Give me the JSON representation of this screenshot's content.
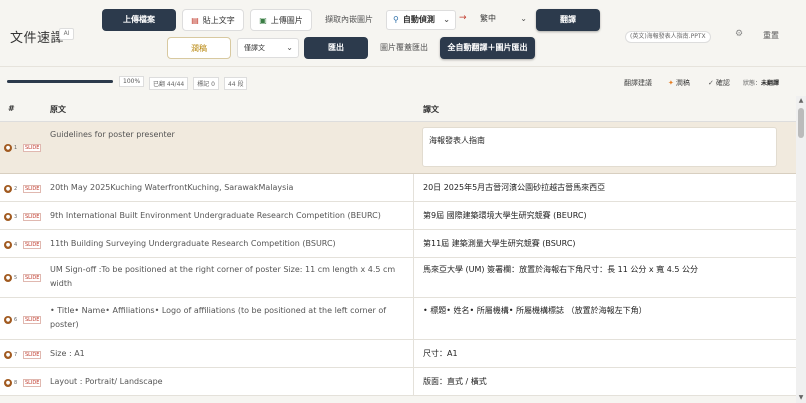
{
  "header": {
    "brand": "文件速譯",
    "ai_badge": "AI",
    "upload_file": "上傳檔案",
    "paste_text": "貼上文字",
    "upload_image": "上傳圖片",
    "capture_images": "擷取內嵌圖片",
    "source_lang": "自動偵測",
    "target_lang": "繁中",
    "translate": "翻譯",
    "proofread": "潤稿",
    "style_select": "僅譯文",
    "export": "匯出",
    "image_overlay_export": "圖片覆蓋匯出",
    "auto_translate_export": "全自動翻譯＋圖片匯出",
    "filename": "(英文)海報發表人指南.PPTX",
    "reset": "重置"
  },
  "progress": {
    "percent_value": 100,
    "percent_label": "100%",
    "translated": "已翻 44/44",
    "marked": "標記 0",
    "segments": "44 段",
    "translate_suggest": "翻譯建議",
    "proof": "潤稿",
    "confirm": "確認",
    "status_label": "狀態：",
    "status_value": "未翻譯"
  },
  "table": {
    "col_num": "#",
    "col_source": "原文",
    "col_target": "譯文",
    "rows": [
      {
        "num": "1",
        "tag": "SLIDE",
        "source": "Guidelines for poster presenter",
        "target": "海報發表人指南"
      },
      {
        "num": "2",
        "tag": "SLIDE",
        "source": "20th May 2025Kuching WaterfrontKuching, SarawakMalaysia",
        "target": "20日 2025年5月古晉河濱公園砂拉越古晉馬來西亞"
      },
      {
        "num": "3",
        "tag": "SLIDE",
        "source": "9th International Built Environment Undergraduate Research Competition (BEURC)",
        "target": "第9屆 國際建築環境大學生研究競賽 (BEURC)"
      },
      {
        "num": "4",
        "tag": "SLIDE",
        "source": "11th Building Surveying Undergraduate Research Competition (BSURC)",
        "target": "第11屆 建築測量大學生研究競賽 (BSURC)"
      },
      {
        "num": "5",
        "tag": "SLIDE",
        "source": "UM Sign-off :To be positioned at the right corner of poster Size: 11 cm length x 4.5 cm width",
        "target": "馬來亞大學 (UM) 簽署欄：放置於海報右下角尺寸：長 11 公分 x 寬 4.5 公分"
      },
      {
        "num": "6",
        "tag": "SLIDE",
        "source": "• Title• Name• Affiliations• Logo of affiliations   (to be positioned at the left corner of poster)",
        "target": "• 標題• 姓名• 所屬機構• 所屬機構標誌  （放置於海報左下角）"
      },
      {
        "num": "7",
        "tag": "SLIDE",
        "source": "Size : A1",
        "target": "尺寸：A1"
      },
      {
        "num": "8",
        "tag": "SLIDE",
        "source": "Layout : Portrait/ Landscape",
        "target": "版面：直式 / 橫式"
      }
    ]
  },
  "icons": {
    "paste": "clipboard-icon",
    "image": "image-icon",
    "search": "search-icon",
    "gear": "gear-icon"
  },
  "colors": {
    "accent_dark": "#2c3a4c",
    "row_badge": "#a15a20",
    "selected_row": "#f1eade"
  }
}
